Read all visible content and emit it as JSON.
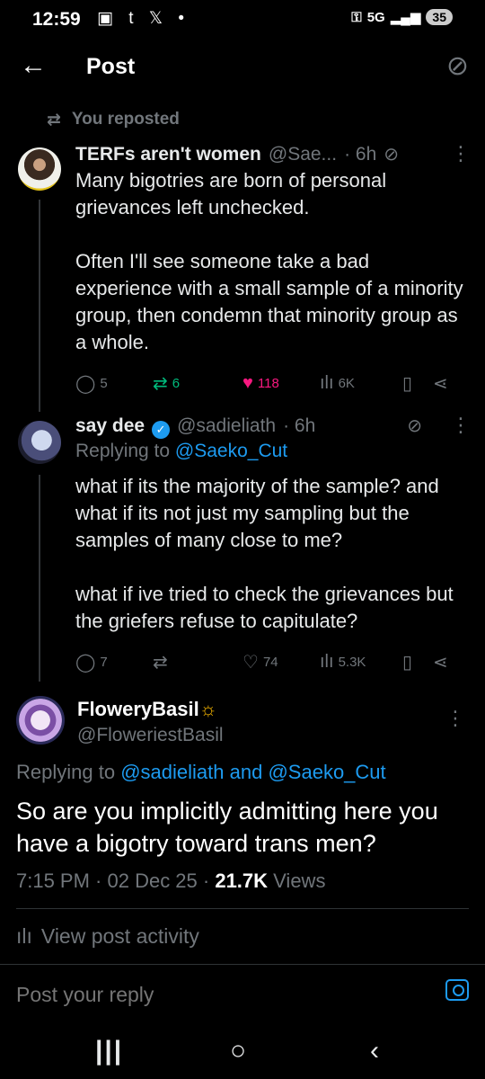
{
  "status_bar": {
    "time": "12:59",
    "left_icons": "▣ t 𝕏 •",
    "network": "5G",
    "battery": "35"
  },
  "header": {
    "title": "Post"
  },
  "repost_notice": "You reposted",
  "tweet1": {
    "name": "TERFs aren't women",
    "handle": "@Sae...",
    "time": "· 6h",
    "text": "Many bigotries are born of personal grievances left unchecked.\n\nOften I'll see someone take a bad experience with a small sample of a minority group, then condemn that minority group as a whole.",
    "replies": "5",
    "reposts": "6",
    "likes": "118",
    "views": "6K"
  },
  "tweet2": {
    "name": "say dee",
    "handle": "@sadieliath",
    "time": "· 6h",
    "replying_prefix": "Replying to",
    "replying_to": "@Saeko_Cut",
    "text": "what if its the majority of the sample? and what if its not just my sampling but the samples of many close to me?\n\nwhat if ive tried to check the grievances but the griefers refuse to capitulate?",
    "replies": "7",
    "reposts": "",
    "likes": "74",
    "views": "5.3K"
  },
  "main_post": {
    "name": "FloweryBasil",
    "handle": "@FloweriestBasil",
    "replying_prefix": "Replying to",
    "replying_to_1": "@sadieliath",
    "and": "and",
    "replying_to_2": "@Saeko_Cut",
    "text": "So are you implicitly admitting here you have a bigotry toward trans men?",
    "time": "7:15 PM · 02 Dec 25 · ",
    "views_count": "21.7K",
    "views_label": " Views"
  },
  "activity_label": "View post activity",
  "reply_placeholder": "Post your reply"
}
